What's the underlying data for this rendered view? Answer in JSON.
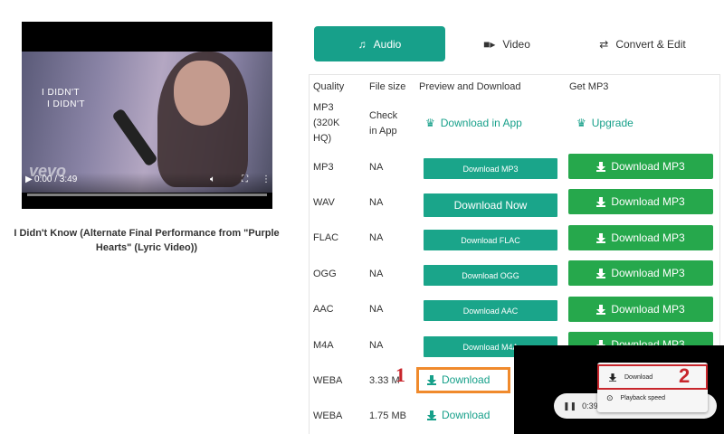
{
  "video": {
    "lyric_line1": "I DIDN'T",
    "lyric_line2": "I DIDN'T",
    "watermark": "vevo",
    "time": "0:00 / 3:49",
    "title": "I Didn't Know (Alternate Final Performance from \"Purple Hearts\" (Lyric Video))"
  },
  "tabs": [
    {
      "label": "Audio",
      "icon": "music-note-icon",
      "active": true
    },
    {
      "label": "Video",
      "icon": "video-camera-icon",
      "active": false
    },
    {
      "label": "Convert & Edit",
      "icon": "convert-icon",
      "active": false
    }
  ],
  "table": {
    "headers": [
      "Quality",
      "File size",
      "Preview and Download",
      "Get MP3"
    ],
    "rows": [
      {
        "quality": "MP3\n(320K\nHQ)",
        "size": "Check\nin App",
        "preview": "Download in App",
        "getmp3": "Upgrade"
      },
      {
        "quality": "MP3",
        "size": "NA",
        "preview": "Download MP3",
        "getmp3": "Download MP3"
      },
      {
        "quality": "WAV",
        "size": "NA",
        "preview": "Download Now",
        "getmp3": "Download MP3"
      },
      {
        "quality": "FLAC",
        "size": "NA",
        "preview": "Download FLAC",
        "getmp3": "Download MP3"
      },
      {
        "quality": "OGG",
        "size": "NA",
        "preview": "Download OGG",
        "getmp3": "Download MP3"
      },
      {
        "quality": "AAC",
        "size": "NA",
        "preview": "Download AAC",
        "getmp3": "Download MP3"
      },
      {
        "quality": "M4A",
        "size": "NA",
        "preview": "Download M4A",
        "getmp3": "Download MP3"
      },
      {
        "quality": "WEBA",
        "size": "3.33 M",
        "preview": "Download",
        "getmp3": ""
      },
      {
        "quality": "WEBA",
        "size": "1.75 MB",
        "preview": "Download",
        "getmp3": ""
      }
    ]
  },
  "popup": {
    "time": "0:39 /",
    "menu_download": "Download",
    "menu_speed": "Playback speed"
  },
  "annotations": {
    "step1": "1",
    "step2": "2"
  },
  "colors": {
    "accent": "#17a08a",
    "green_button": "#26a84c",
    "highlight_orange": "#f08a2c",
    "highlight_red": "#c8262c"
  }
}
